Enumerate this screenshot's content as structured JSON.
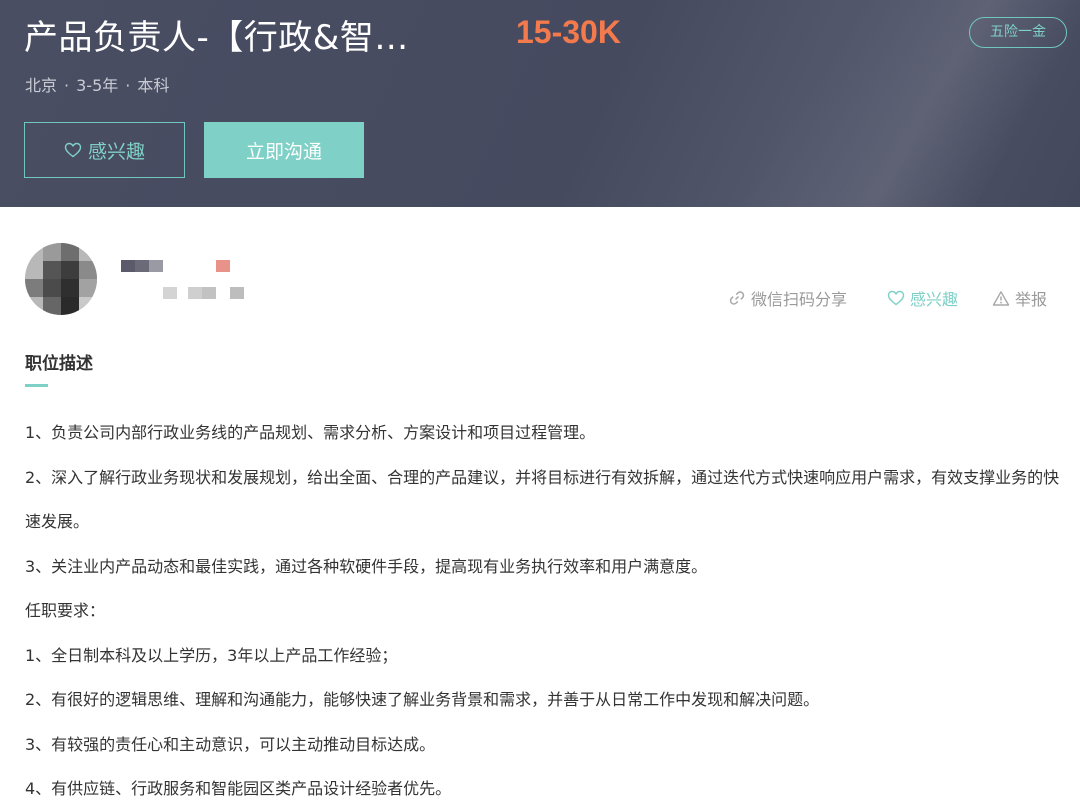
{
  "header": {
    "title": "产品负责人-【行政&智…",
    "salary": "15-30K",
    "benefit_tag": "五险一金",
    "meta": {
      "city": "北京",
      "experience": "3-5年",
      "education": "本科",
      "separator": "·"
    },
    "interest_button": "感兴趣",
    "chat_button": "立即沟通"
  },
  "actions": {
    "share": "微信扫码分享",
    "like": "感兴趣",
    "report": "举报"
  },
  "section": {
    "title": "职位描述"
  },
  "description": [
    "1、负责公司内部行政业务线的产品规划、需求分析、方案设计和项目过程管理。",
    "2、深入了解行政业务现状和发展规划，给出全面、合理的产品建议，并将目标进行有效拆解，通过迭代方式快速响应用户需求，有效支撑业务的快速发展。",
    "3、关注业内产品动态和最佳实践，通过各种软硬件手段，提高现有业务执行效率和用户满意度。",
    "任职要求：",
    "1、全日制本科及以上学历，3年以上产品工作经验；",
    "2、有很好的逻辑思维、理解和沟通能力，能够快速了解业务背景和需求，并善于从日常工作中发现和解决问题。",
    "3、有较强的责任心和主动意识，可以主动推动目标达成。",
    "4、有供应链、行政服务和智能园区类产品设计经验者优先。"
  ],
  "colors": {
    "header_bg": "#494d62",
    "accent": "#7fd0c6",
    "salary": "#f27a4d"
  }
}
